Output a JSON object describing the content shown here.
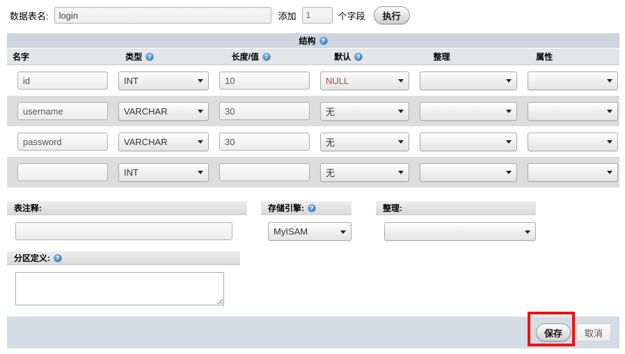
{
  "toolbar": {
    "table_name_label": "数据表名:",
    "table_name_value": "login",
    "add_label": "添加",
    "add_count_value": "1",
    "fields_label": "个字段",
    "go_label": "执行"
  },
  "structure": {
    "section_title": "结构",
    "columns": {
      "name": "名字",
      "type": "类型",
      "length": "长度/值",
      "default": "默认",
      "collation": "整理",
      "attributes": "属性"
    },
    "rows": [
      {
        "name": "id",
        "type": "INT",
        "length": "10",
        "default": "NULL",
        "collation": "",
        "attributes": ""
      },
      {
        "name": "username",
        "type": "VARCHAR",
        "length": "30",
        "default": "无",
        "collation": "",
        "attributes": ""
      },
      {
        "name": "password",
        "type": "VARCHAR",
        "length": "30",
        "default": "无",
        "collation": "",
        "attributes": ""
      },
      {
        "name": "",
        "type": "INT",
        "length": "",
        "default": "无",
        "collation": "",
        "attributes": ""
      }
    ]
  },
  "options": {
    "comment_label": "表注释:",
    "comment_value": "",
    "engine_label": "存储引擎:",
    "engine_value": "MyISAM",
    "collation_label": "整理:",
    "collation_value": "",
    "partition_label": "分区定义:",
    "partition_value": ""
  },
  "footer": {
    "save_label": "保存",
    "cancel_label": "取消"
  },
  "colors": {
    "highlight_box": "#ee1111",
    "header_band": "#ccd4de",
    "footer_band": "#d4dce6",
    "alt_row": "#dddddd"
  }
}
